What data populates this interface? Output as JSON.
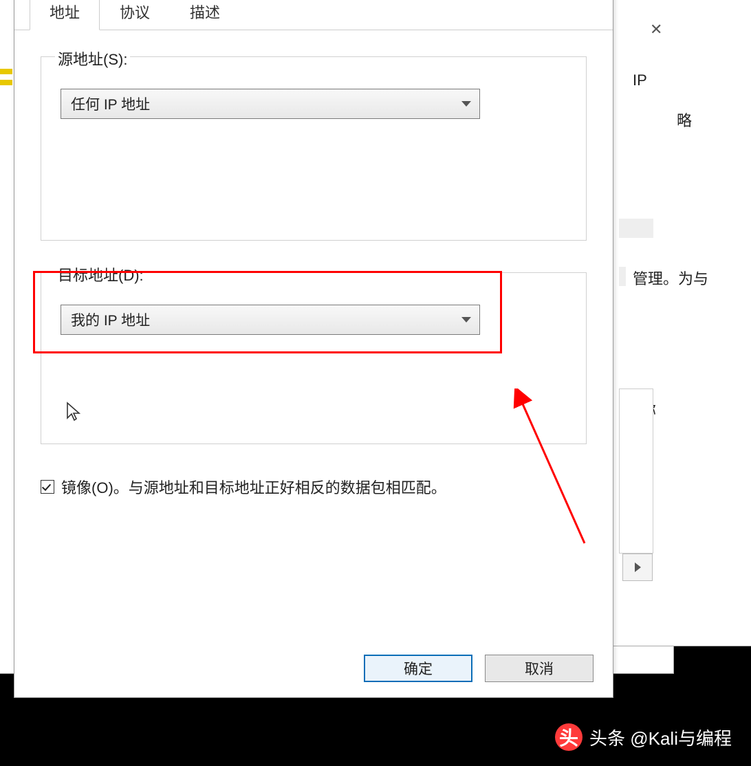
{
  "tabs": {
    "address": "地址",
    "protocol": "协议",
    "description": "描述"
  },
  "source": {
    "label": "源地址(S):",
    "selected": "任何 IP 地址"
  },
  "destination": {
    "label": "目标地址(D):",
    "selected": "我的 IP 地址"
  },
  "mirror": {
    "label": "镜像(O)。与源地址和目标地址正好相反的数据包相匹配。"
  },
  "buttons": {
    "ok": "确定",
    "cancel": "取消"
  },
  "bg": {
    "ip": "IP",
    "lue": "略",
    "guanli": "管理。为与",
    "mingcheng": "名称"
  },
  "watermark": {
    "logo": "头",
    "text": "头条 @Kali与编程"
  }
}
